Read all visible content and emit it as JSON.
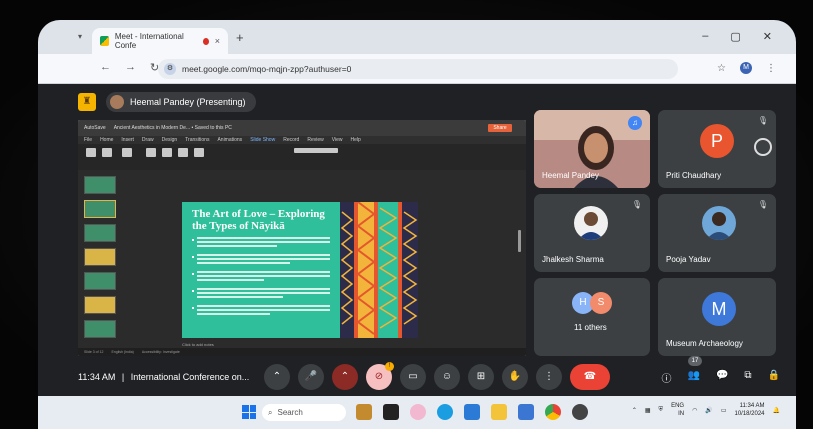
{
  "browser": {
    "tab_title": "Meet - International Confe",
    "tab_close": "×",
    "new_tab": "+",
    "url": "meet.google.com/mqo-mqjn-zpp?authuser=0",
    "profile_initial": "M",
    "win_min": "–",
    "win_max": "▢",
    "win_close": "✕"
  },
  "meet": {
    "presenter_label": "Heemal Pandey (Presenting)",
    "slide": {
      "title": "The Art of Love – Exploring the Types of Nāyikā"
    },
    "ppt": {
      "autosave": "AutoSave",
      "file_name": "Ancient Aesthetics in Modern De... • Saved to this PC",
      "share": "Share",
      "menu": [
        "File",
        "Home",
        "Insert",
        "Draw",
        "Design",
        "Transitions",
        "Animations",
        "Slide Show",
        "Record",
        "Review",
        "View",
        "Help"
      ],
      "notes_hint": "Click to add notes",
      "status_slide": "Slide 3 of 12",
      "status_lang": "English (India)",
      "status_access": "Accessibility: Investigate"
    },
    "tiles": {
      "heemal": "Heemal Pandey",
      "priti": "Priti Chaudhary",
      "priti_initial": "P",
      "jhalkesh": "Jhalkesh Sharma",
      "pooja": "Pooja Yadav",
      "others": "11 others",
      "others_i1": "H",
      "others_i2": "S",
      "museum": "Museum Archaeology",
      "museum_initial": "M"
    },
    "bottom": {
      "time": "11:34 AM",
      "separator": "|",
      "meeting_name": "International Conference on...",
      "raise_badge": "!",
      "people_count": "17"
    }
  },
  "taskbar": {
    "search_placeholder": "Search",
    "lang": "ENG",
    "region": "IN",
    "time": "11:34 AM",
    "date": "10/18/2024"
  },
  "colors": {
    "meet_bg": "#202124",
    "tile_bg": "#3c4043",
    "hangup": "#ea4335",
    "priti_avatar": "#e8552e",
    "museum_avatar": "#3e78d8",
    "slide_teal": "#2fbf9a"
  }
}
